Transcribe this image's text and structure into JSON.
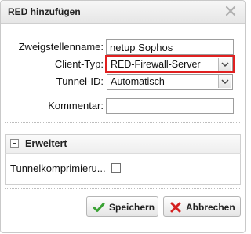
{
  "dialog": {
    "title": "RED hinzufügen",
    "close_icon": "close-icon"
  },
  "form": {
    "branch_name": {
      "label": "Zweigstellenname:",
      "value": "netup Sophos"
    },
    "client_type": {
      "label": "Client-Typ:",
      "value": "RED-Firewall-Server"
    },
    "tunnel_id": {
      "label": "Tunnel-ID:",
      "value": "Automatisch"
    },
    "comment": {
      "label": "Kommentar:",
      "value": ""
    }
  },
  "advanced": {
    "title": "Erweitert",
    "tunnel_compression": {
      "label": "Tunnelkomprimieru...",
      "checked": false
    }
  },
  "buttons": {
    "save_label": "Speichern",
    "cancel_label": "Abbrechen"
  },
  "colors": {
    "highlight": "#e02020",
    "save_icon": "#3aa234",
    "cancel_icon": "#d42020"
  }
}
